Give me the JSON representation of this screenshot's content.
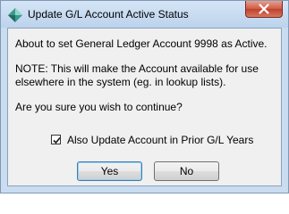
{
  "window": {
    "title": "Update G/L Account Active Status"
  },
  "message": {
    "line1": "About to set General Ledger Account 9998 as Active.",
    "note_line1": "NOTE: This will make the Account available for use",
    "note_line2": "elsewhere in the system (eg. in lookup lists).",
    "question": "Are you sure you wish to continue?"
  },
  "option": {
    "label": "Also Update Account in Prior G/L Years",
    "checked": true
  },
  "buttons": {
    "yes": "Yes",
    "no": "No"
  },
  "icons": {
    "app": "diamond-app-icon",
    "close": "close-icon"
  },
  "colors": {
    "frame": "#c9dcf0",
    "client": "#f0f0f0",
    "close_button": "#c0412c",
    "default_button_border": "#3c7fb1"
  }
}
